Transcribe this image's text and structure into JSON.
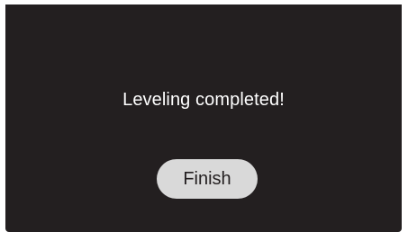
{
  "dialog": {
    "message": "Leveling completed!",
    "finish_label": "Finish"
  },
  "colors": {
    "screen_background": "#231f20",
    "text": "#ffffff",
    "button_background": "#d9d9d9",
    "button_text": "#231f20"
  }
}
